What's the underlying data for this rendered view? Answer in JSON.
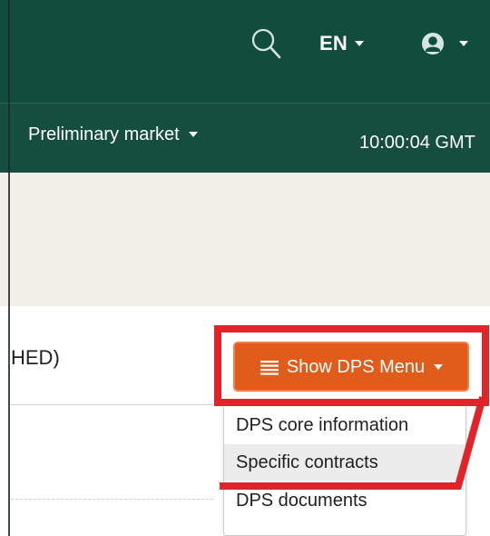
{
  "header": {
    "language": "EN",
    "icons": {
      "search": "search-icon",
      "user": "user-circle-icon"
    }
  },
  "subnav": {
    "market_label": "Preliminary market",
    "time": "10:00:04 GMT"
  },
  "content": {
    "status_fragment": "HED)",
    "dps_button_label": "Show DPS Menu",
    "dps_menu": {
      "items": [
        {
          "label": "DPS core information"
        },
        {
          "label": "Specific contracts"
        },
        {
          "label": "DPS documents"
        }
      ]
    }
  },
  "colors": {
    "header_bg": "#114d3c",
    "subnav_bg": "#154d3f",
    "gray_band": "#f1efe8",
    "button_bg": "#e15b1b",
    "annotation_red": "#e1232a",
    "menu_hover": "#ececec"
  }
}
